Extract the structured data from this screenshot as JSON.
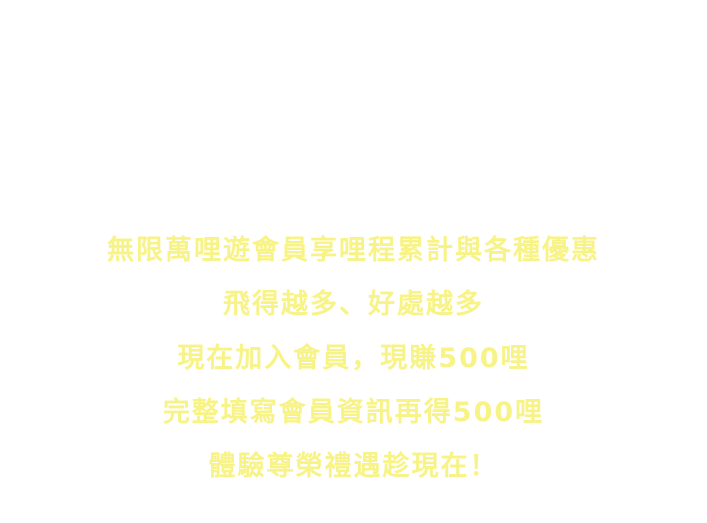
{
  "theme": {
    "text_color": "#f8f386"
  },
  "promo": {
    "lines": [
      "無限萬哩遊會員享哩程累計與各種優惠",
      "飛得越多、好處越多",
      "現在加入會員，現賺500哩",
      "完整填寫會員資訊再得500哩",
      "體驗尊榮禮遇趁現在！"
    ]
  }
}
